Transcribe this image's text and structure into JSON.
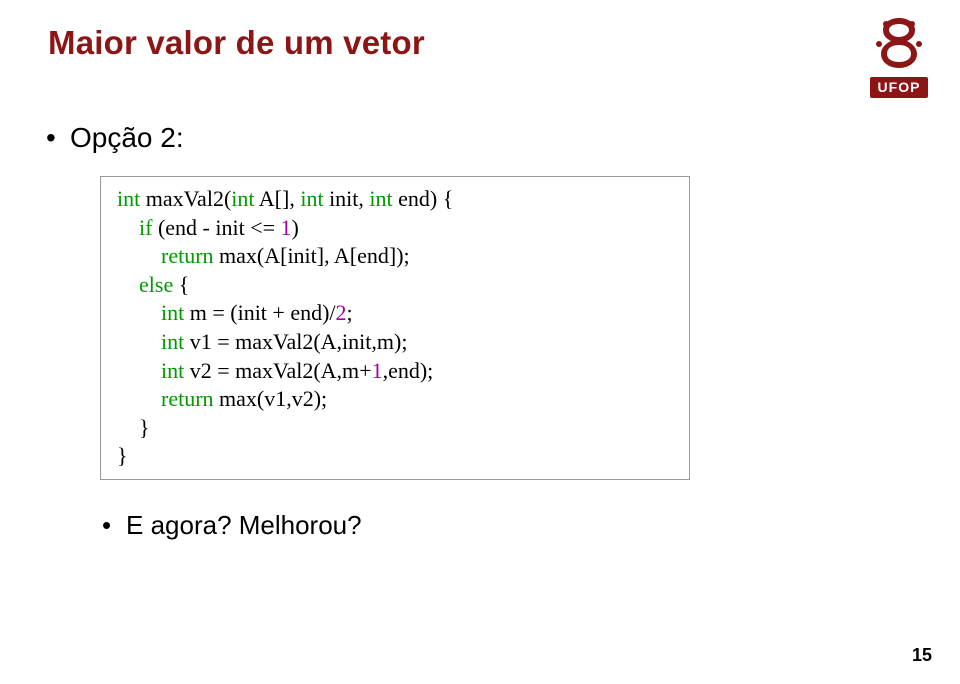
{
  "title": "Maior valor de um vetor",
  "logo_text": "UFOP",
  "bullet_main": "Opção 2:",
  "bullet_sub": "E agora? Melhorou?",
  "page_number": "15",
  "code": {
    "l1a": "int",
    "l1b": " maxVal2(",
    "l1c": "int",
    "l1d": " A[], ",
    "l1e": "int",
    "l1f": " init, ",
    "l1g": "int",
    "l1h": " end) {",
    "l2a": "    if",
    "l2b": " (end - init <= ",
    "l2c": "1",
    "l2d": ")",
    "l3a": "        return",
    "l3b": " max(A[init], A[end]);",
    "l4a": "    else",
    "l4b": " {",
    "l5a": "        int",
    "l5b": " m = (init + end)/",
    "l5c": "2",
    "l5d": ";",
    "l6a": "        int",
    "l6b": " v1 = maxVal2(A,init,m);",
    "l7a": "        int",
    "l7b": " v2 = maxVal2(A,m+",
    "l7c": "1",
    "l7d": ",end);",
    "l8a": "        return",
    "l8b": " max(v1,v2);",
    "l9": "    }",
    "l10": "}"
  }
}
